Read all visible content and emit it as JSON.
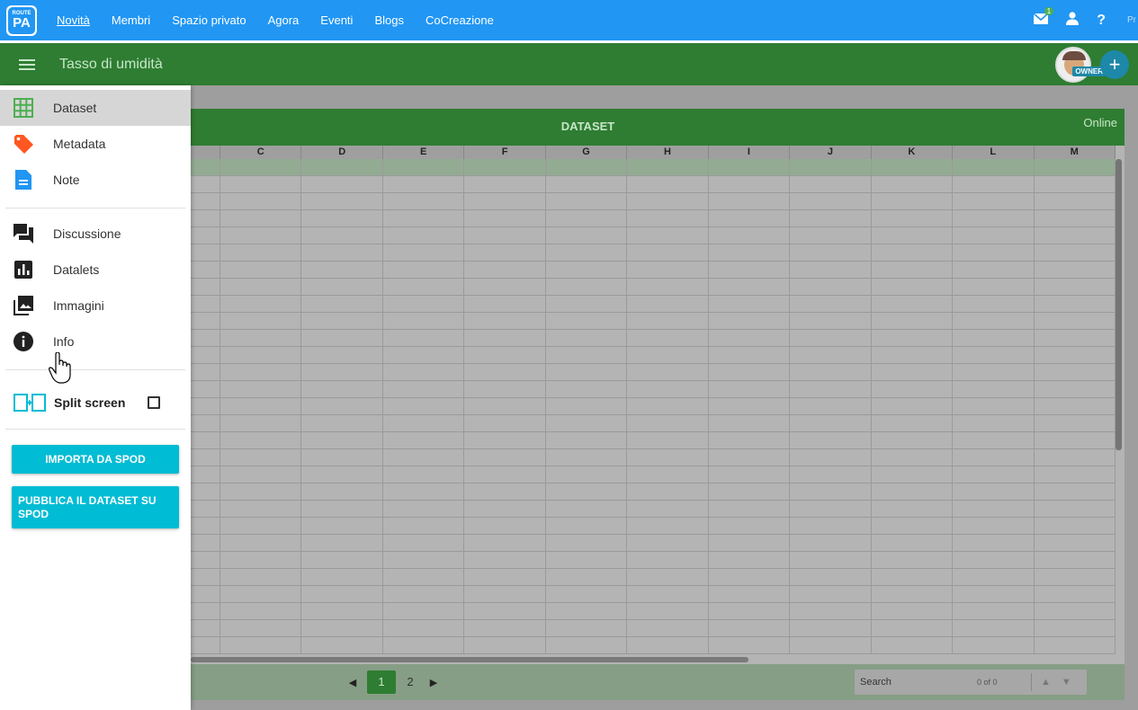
{
  "topnav": {
    "logo_top": "ROUTE",
    "logo_main": "PA",
    "links": [
      "Novità",
      "Membri",
      "Spazio privato",
      "Agora",
      "Eventi",
      "Blogs",
      "CoCreazione"
    ],
    "mail_badge": "1",
    "help_icon": "?",
    "cut_text": "Pr"
  },
  "header": {
    "title": "Tasso di umidità",
    "owner_badge": "OWNER",
    "fab": "+"
  },
  "panel": {
    "title": "DATASET",
    "status": "Online",
    "columns": [
      "C",
      "D",
      "E",
      "F",
      "G",
      "H",
      "I",
      "J",
      "K",
      "L",
      "M"
    ],
    "pager": {
      "prev": "◀",
      "pages": [
        "1",
        "2"
      ],
      "active_page": "1",
      "next": "▶"
    },
    "search": {
      "placeholder": "Search",
      "count": "0 of 0",
      "up": "▲",
      "down": "▼"
    }
  },
  "sidebar": {
    "items": [
      {
        "label": "Dataset",
        "icon": "grid-icon",
        "color": "#4caf50"
      },
      {
        "label": "Metadata",
        "icon": "tag-icon",
        "color": "#ff5722"
      },
      {
        "label": "Note",
        "icon": "note-icon",
        "color": "#2196f3"
      },
      {
        "label": "Discussione",
        "icon": "forum-icon",
        "color": "#212121"
      },
      {
        "label": "Datalets",
        "icon": "chart-icon",
        "color": "#212121"
      },
      {
        "label": "Immagini",
        "icon": "images-icon",
        "color": "#212121"
      },
      {
        "label": "Info",
        "icon": "info-icon",
        "color": "#212121"
      }
    ],
    "split_label": "Split screen",
    "import_button": "IMPORTA DA SPOD",
    "publish_button": "PUBBLICA IL DATASET SU SPOD"
  }
}
